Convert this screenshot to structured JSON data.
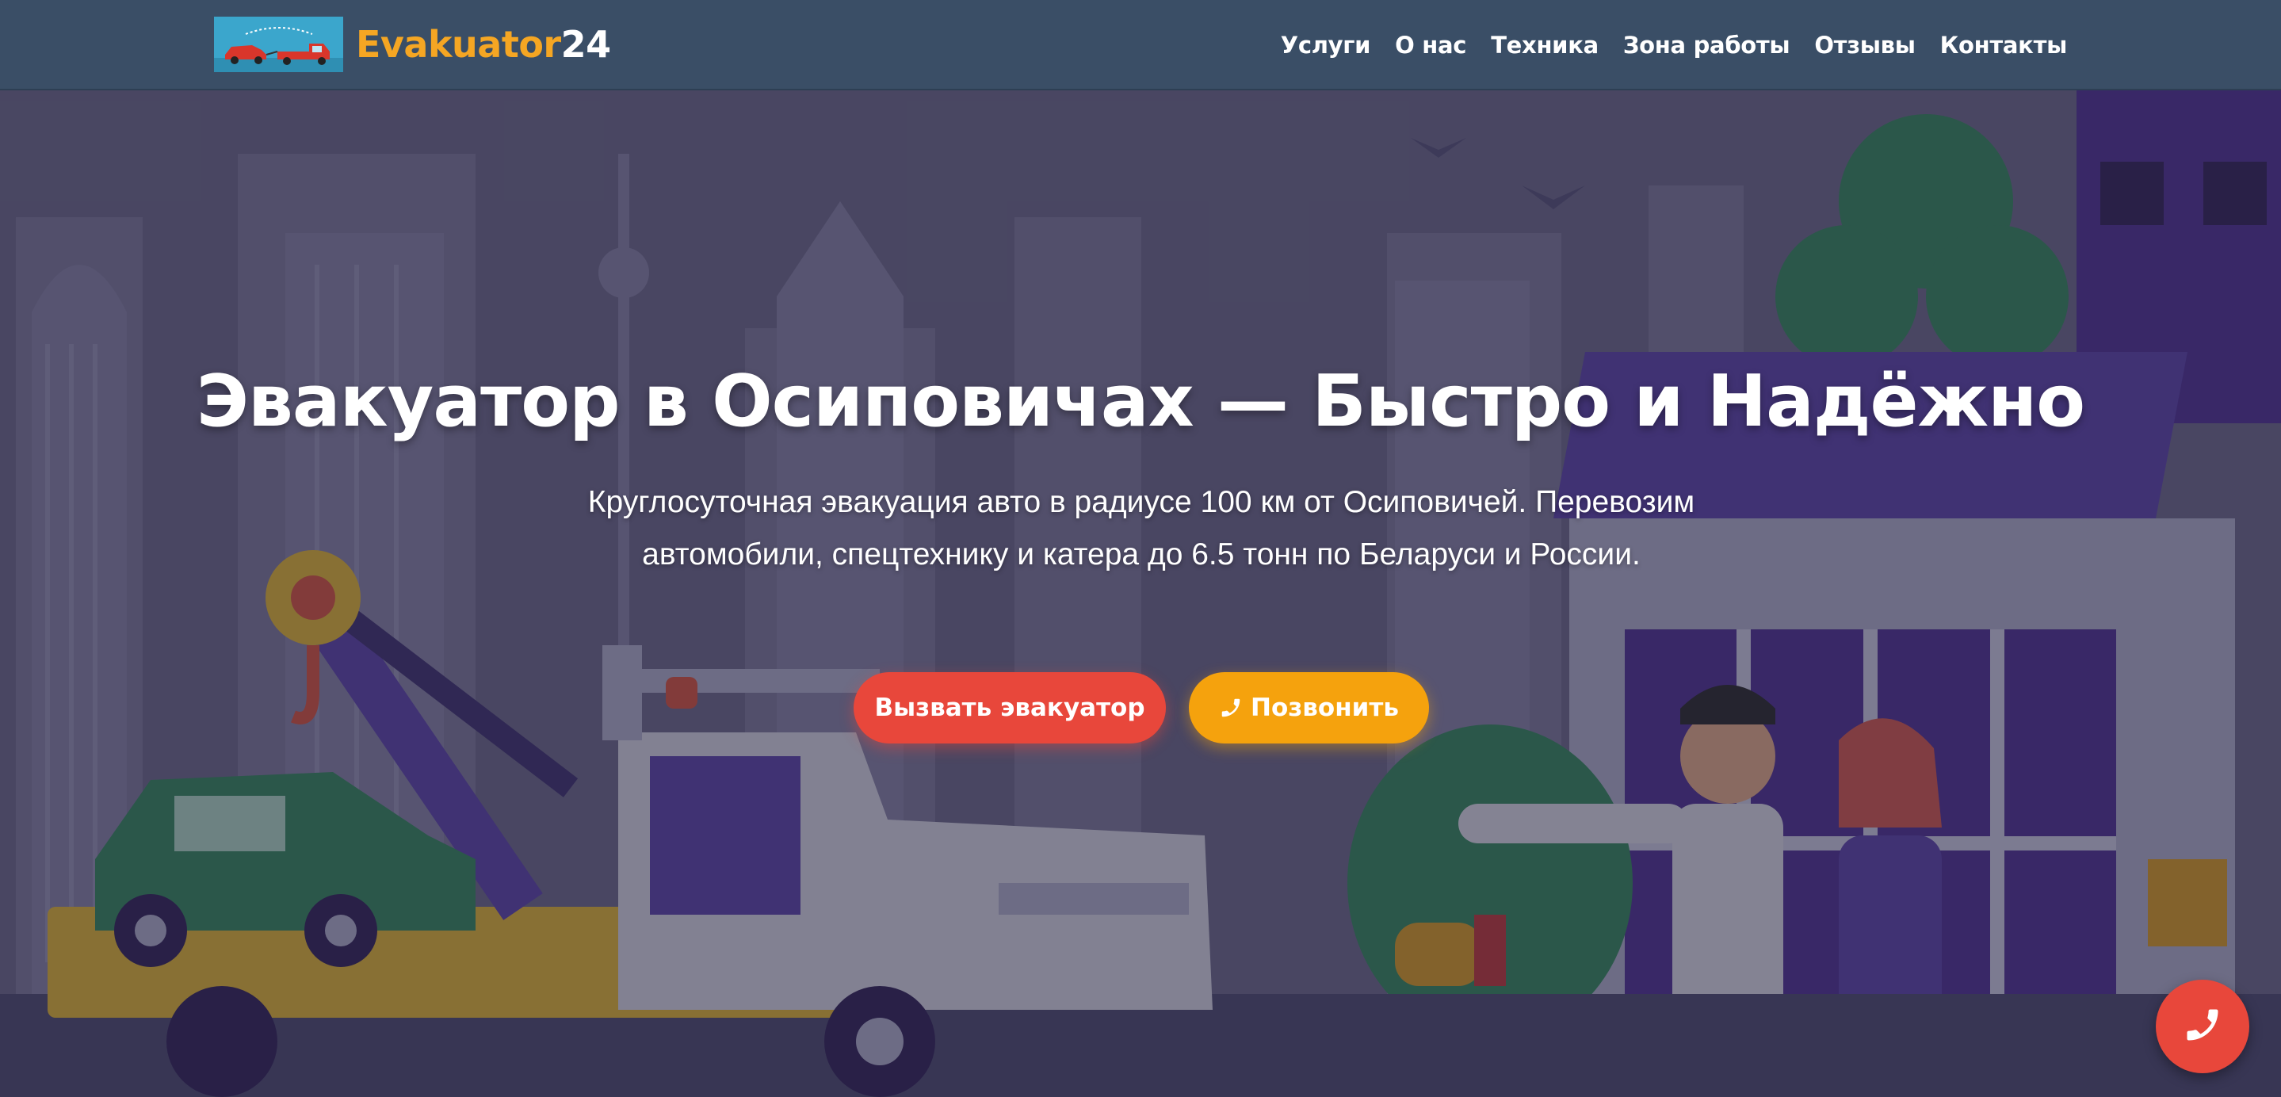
{
  "header": {
    "brand_name": "Evakuator",
    "brand_number": "24",
    "nav": [
      {
        "label": "Услуги"
      },
      {
        "label": "О нас"
      },
      {
        "label": "Техника"
      },
      {
        "label": "Зона работы"
      },
      {
        "label": "Отзывы"
      },
      {
        "label": "Контакты"
      }
    ]
  },
  "hero": {
    "title": "Эвакуатор в Осиповичах — Быстро и Надёжно",
    "subtitle": "Круглосуточная эвакуация авто в радиусе 100 км от Осиповичей. Перевозим автомобили, спецтехнику и катера до 6.5 тонн по Беларуси и России.",
    "primary_button": "Вызвать эвакуатор",
    "secondary_button": "Позвонить",
    "secondary_button_icon": "phone-icon"
  },
  "floating_button": {
    "icon": "phone-icon"
  },
  "colors": {
    "header_bg": "#3a4e66",
    "brand_accent": "#f5a623",
    "primary_button": "#e8473b",
    "secondary_button": "#f5a20d"
  }
}
